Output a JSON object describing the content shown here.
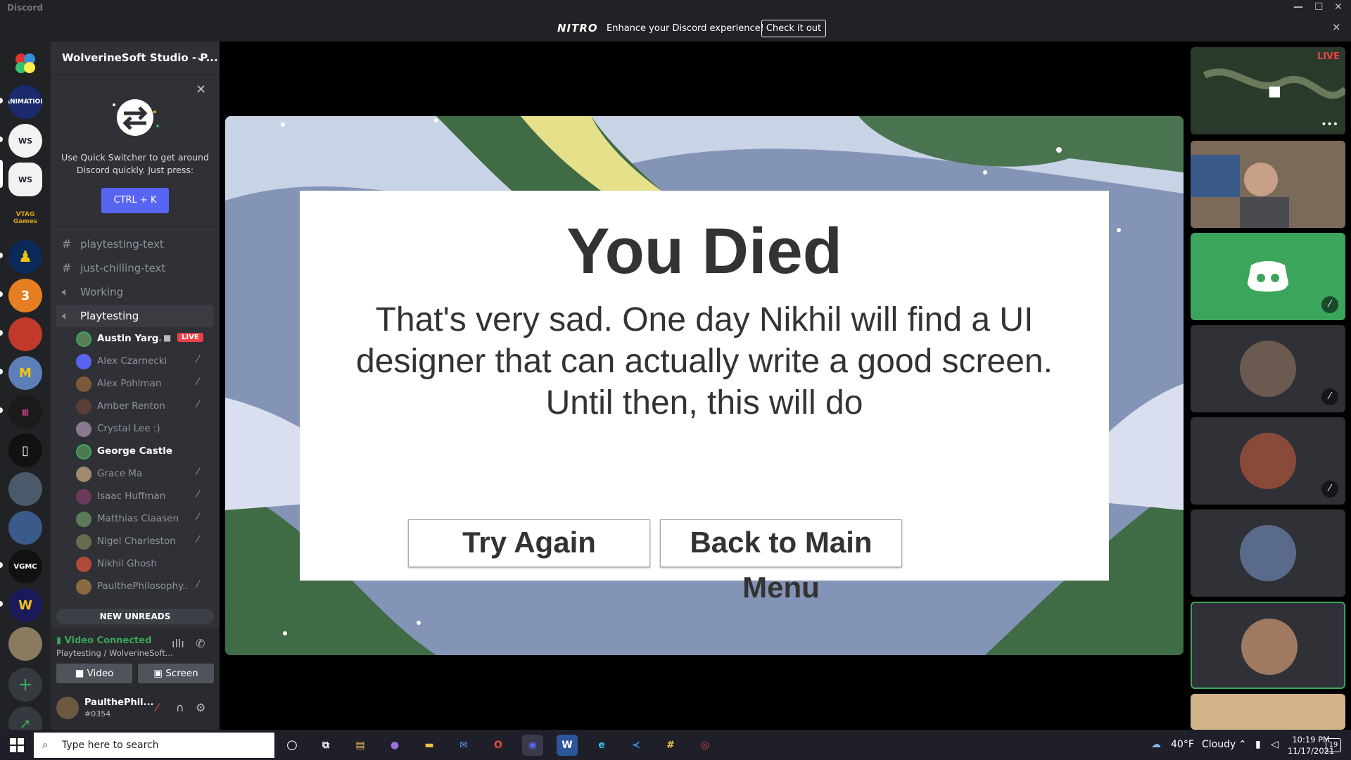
{
  "app": {
    "title": "Discord"
  },
  "nitro": {
    "logo": "NITRO",
    "message": "Enhance your Discord experience!",
    "button": "Check it out"
  },
  "server": {
    "name": "WolverineSoft Studio - P..."
  },
  "tip": {
    "text": "Use Quick Switcher to get around Discord quickly. Just press:",
    "shortcut": "CTRL + K"
  },
  "channels": [
    {
      "type": "text",
      "name": "playtesting-text"
    },
    {
      "type": "text",
      "name": "just-chilling-text"
    },
    {
      "type": "voice",
      "name": "Working"
    },
    {
      "type": "voice",
      "name": "Playtesting",
      "selected": true
    }
  ],
  "members": [
    {
      "name": "Austin Yarg...",
      "active": true,
      "live": "LIVE",
      "color": "#5b7c5a"
    },
    {
      "name": "Alex Czarnecki",
      "color": "#5865f2"
    },
    {
      "name": "Alex Pohlman",
      "color": "#7a5a3a"
    },
    {
      "name": "Amber Renton",
      "color": "#5a3e36"
    },
    {
      "name": "Crystal Lee :)",
      "color": "#8a7a90"
    },
    {
      "name": "George Castle",
      "active": true,
      "color": "#4d7a54"
    },
    {
      "name": "Grace Ma",
      "color": "#a08a70"
    },
    {
      "name": "Isaac Huffman",
      "color": "#6a3a5a"
    },
    {
      "name": "Matthias Claasen",
      "color": "#5a7a5a"
    },
    {
      "name": "Nigel Charleston",
      "color": "#6a6a50"
    },
    {
      "name": "Nikhil Ghosh",
      "color": "#b04a3a"
    },
    {
      "name": "PaulthePhilosophy...",
      "color": "#8a6a40"
    }
  ],
  "new_unreads": "NEW UNREADS",
  "voice": {
    "status": "Video Connected",
    "location": "Playtesting / WolverineSoft...",
    "video": "Video",
    "screen": "Screen"
  },
  "user": {
    "name": "PaulthePhil...",
    "tag": "#0354"
  },
  "game": {
    "title": "You Died",
    "message": "That's very sad. One day Nikhil will find a UI designer that can actually write a good screen. Until then, this will do",
    "try_again": "Try Again",
    "main_menu": "Back to Main Menu"
  },
  "stream": {
    "live": "LIVE"
  },
  "taskbar": {
    "search_placeholder": "Type here to search",
    "temperature": "40°F",
    "weather": "Cloudy",
    "time": "10:19 PM",
    "date": "11/17/2021",
    "notifications": "19"
  }
}
